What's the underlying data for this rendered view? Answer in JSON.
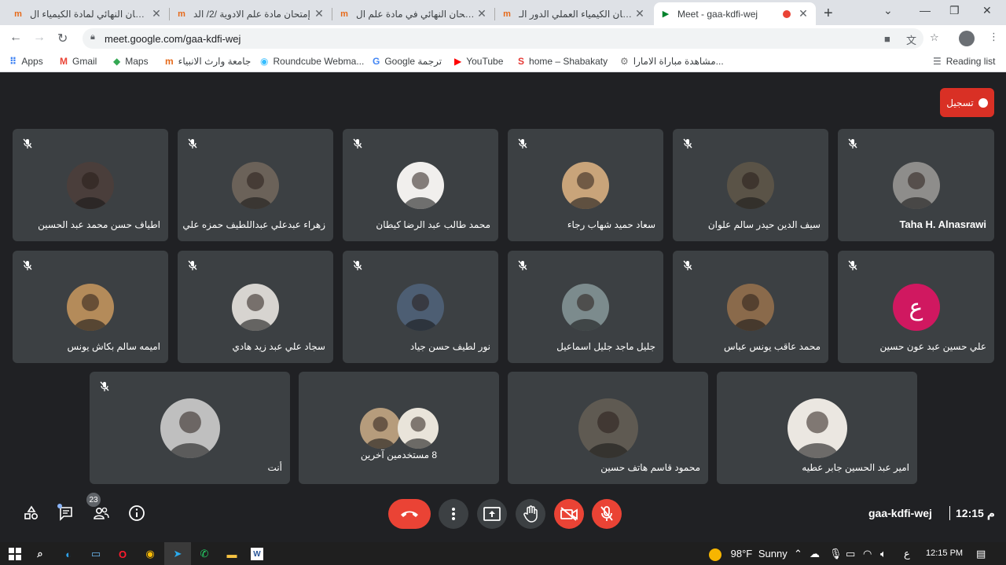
{
  "tabs": [
    {
      "title": "الامتحان النهائي لمادة الكيمياء ال",
      "active": false
    },
    {
      "title": "إمتحان مادة علم الادوية /2/ الد",
      "active": false
    },
    {
      "title": "الإمتحان النهائي في مادة علم ال",
      "active": false
    },
    {
      "title": "امتحان الكيمياء العملي الدور الـ",
      "active": false
    },
    {
      "title": "Meet - gaa-kdfi-wej",
      "active": true
    }
  ],
  "address_bar": {
    "url": "meet.google.com/gaa-kdfi-wej"
  },
  "bookmarks": [
    {
      "label": "Apps",
      "icon": "apps-grid-icon"
    },
    {
      "label": "Gmail",
      "icon": "gmail-icon"
    },
    {
      "label": "Maps",
      "icon": "maps-icon"
    },
    {
      "label": "جامعة وارث الانبياء",
      "icon": "site-icon"
    },
    {
      "label": "Roundcube Webma...",
      "icon": "roundcube-icon"
    },
    {
      "label": "Google ترجمة",
      "icon": "translate-icon"
    },
    {
      "label": "YouTube",
      "icon": "youtube-icon"
    },
    {
      "label": "home – Shabakaty",
      "icon": "shabakaty-icon"
    },
    {
      "label": "مشاهدة مباراة الامارا...",
      "icon": "sport-icon"
    }
  ],
  "reading_list": "Reading list",
  "recording_label": "تسجيل",
  "participants": [
    {
      "name": "Taha H. Alnasrawi",
      "avatar_color": "#8e8d8b",
      "ltr": true
    },
    {
      "name": "سيف الدين حيدر سالم علوان",
      "avatar_color": "#5a5347"
    },
    {
      "name": "سعاد حميد شهاب رجاء",
      "avatar_color": "#c9a47a"
    },
    {
      "name": "محمد طالب عبد الرضا كيطان",
      "avatar_color": "#f1efed"
    },
    {
      "name": "زهراء عبدعلي عبداللطيف حمزه علي",
      "avatar_color": "#6b6259"
    },
    {
      "name": "اطياف حسن محمد عبد الحسين",
      "avatar_color": "#4a3e3b"
    },
    {
      "name": "علي حسين عبد عون حسين",
      "avatar_color": "#d01860",
      "initial": "ع"
    },
    {
      "name": "محمد عاقب يونس عباس",
      "avatar_color": "#8a6a4b"
    },
    {
      "name": "جليل ماجد جليل اسماعيل",
      "avatar_color": "#7c8b8d"
    },
    {
      "name": "نور لطيف حسن جياد",
      "avatar_color": "#4d5e73"
    },
    {
      "name": "سجاد علي عبد زيد هادي",
      "avatar_color": "#d7d4d0"
    },
    {
      "name": "اميمه سالم بكاش يونس",
      "avatar_color": "#b48b5a"
    },
    {
      "name": "امير عبد الحسين جابر عطيه",
      "avatar_color": "#ebe7e1"
    },
    {
      "name": "محمود قاسم هاتف حسين",
      "avatar_color": "#5f5a52"
    },
    {
      "name": "8 مستخدمين آخرين",
      "avatar_color": "#b69c7c",
      "group": true
    },
    {
      "name": "أنت",
      "avatar_color": "#bfbfbf"
    }
  ],
  "controls": {
    "participant_count": "23",
    "meeting_code": "gaa-kdfi-wej",
    "time": "12:15",
    "time_suffix": "م"
  },
  "colors": {
    "meet_bg": "#202124",
    "tile_bg": "#3c4043",
    "danger": "#ea4335"
  },
  "taskbar": {
    "weather_temp": "98°F",
    "weather_text": "Sunny",
    "ime": "ع",
    "clock": "12:15 PM"
  }
}
